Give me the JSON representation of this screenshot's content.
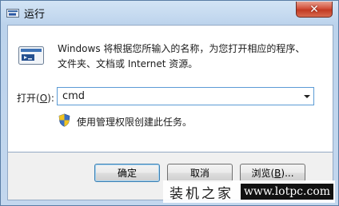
{
  "window": {
    "title": "运行",
    "close_symbol": "✕"
  },
  "dialog": {
    "description_line1": "Windows 将根据您所输入的名称，为您打开相应的程序、",
    "description_line2": "文件夹、文档或 Internet 资源。",
    "open_label_pre": "打开(",
    "open_label_key": "O",
    "open_label_post": "):",
    "command_value": "cmd",
    "admin_note": "使用管理权限创建此任务。"
  },
  "buttons": {
    "ok": "确定",
    "cancel": "取消",
    "browse_pre": "浏览(",
    "browse_key": "B",
    "browse_post": ")..."
  },
  "watermark": {
    "left": "装机之家",
    "right": "www.lotpc.com"
  },
  "icons": [
    "run-app-icon",
    "run-dialog-icon",
    "dropdown-arrow-icon",
    "uac-shield-icon"
  ],
  "colors": {
    "title_glass": "#bcd3ec",
    "close_button": "#c23a22",
    "input_border": "#5b9bd5"
  }
}
